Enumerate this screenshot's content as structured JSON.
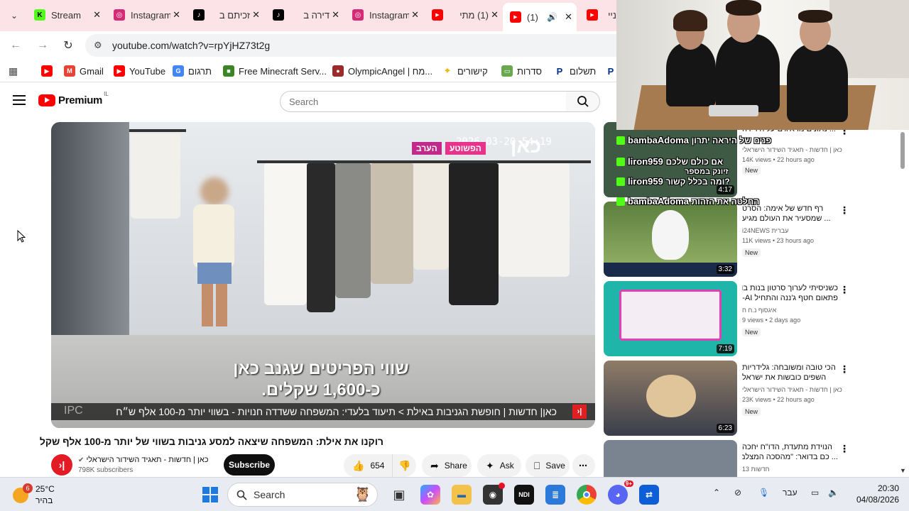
{
  "browser": {
    "tabs": [
      {
        "title": "Stream",
        "favicon": "kick-icon",
        "color": "#53fc18",
        "glyph": "K"
      },
      {
        "title": "Instagram",
        "favicon": "instagram-icon",
        "color": "#d62976",
        "glyph": "◎"
      },
      {
        "title": "זכיתם ב",
        "favicon": "tiktok-icon",
        "color": "#000000",
        "glyph": "♪"
      },
      {
        "title": "דירה ב",
        "favicon": "tiktok-icon",
        "color": "#000000",
        "glyph": "♪"
      },
      {
        "title": "Instagram",
        "favicon": "instagram-icon",
        "color": "#d62976",
        "glyph": "◎"
      },
      {
        "title": "(1) מתי",
        "favicon": "youtube-icon",
        "color": "#ff0000",
        "glyph": "▶"
      },
      {
        "title": "(1)",
        "favicon": "youtube-icon",
        "color": "#ff0000",
        "glyph": "▶",
        "active": true
      },
      {
        "title": "ניי",
        "favicon": "youtube-icon",
        "color": "#ff0000",
        "glyph": "▶"
      }
    ],
    "url": "youtube.com/watch?v=rpYjHZ73t2g",
    "bookmarks": [
      {
        "label": "",
        "icon": "youtube-icon",
        "color": "#ff0000"
      },
      {
        "label": "Gmail",
        "icon": "gmail-icon",
        "color": "#ea4335"
      },
      {
        "label": "YouTube",
        "icon": "youtube-icon",
        "color": "#ff0000"
      },
      {
        "label": "תרגום",
        "icon": "translate-icon",
        "color": "#4285f4"
      },
      {
        "label": "Free Minecraft Serv...",
        "icon": "minecraft-icon",
        "color": "#3c8527"
      },
      {
        "label": "OlympicAngel | מח...",
        "icon": "avatar-icon",
        "color": "#9b2a2a"
      },
      {
        "label": "קישורים",
        "icon": "star-folder-icon",
        "color": "#f4c20d"
      },
      {
        "label": "סדרות",
        "icon": "tv-icon",
        "color": "#6aa84f"
      },
      {
        "label": "תשלום",
        "icon": "paypal-icon",
        "color": "#003087"
      }
    ]
  },
  "youtube": {
    "logo_text": "Premium",
    "country": "IL",
    "search_placeholder": "Search",
    "video": {
      "watermark": "כאן",
      "timestamp": "2026-03-20 54:19",
      "tag1": "הפשוטע",
      "tag2": "הערב",
      "subtitle_line1": "שווי הפריטים שגנב כאן",
      "subtitle_line2": "כ-1,600 שקלים.",
      "ticker_text": "כאן| חדשות  |  חופשת הגניבות באילת > תיעוד בלעדי: המשפחה ששדדה חנויות - בשווי יותר מ-100 אלף ש״ח",
      "ticker_logo": "IPC",
      "brand_glyph": "›|"
    },
    "title": "רוקנו את אילת: המשפחה שיצאה למסע גניבות בשווי של יותר מ-100 אלף שקל",
    "channel": {
      "name": "כאן | חדשות - תאגיד השידור הישראלי",
      "subscribers": "798K subscribers",
      "avatar_glyph": "›|"
    },
    "subscribe_label": "Subscribe",
    "actions": {
      "likes": "654",
      "share": "Share",
      "ask": "Ask",
      "save": "Save"
    },
    "recommendations": [
      {
        "line1": "... נתונים מדאיגים על הירידה",
        "line2": "",
        "channel": "כאן | חדשות - תאגיד השידור הישראלי",
        "meta": "14K views • 22 hours ago",
        "badge": "New",
        "duration": "4:17",
        "thumb": "#3e5a45"
      },
      {
        "line1": "רף חדש של אימה: הסרט",
        "line2": "... שמסעיר את העולם מגיע",
        "channel": "i24NEWS עברית",
        "meta": "11K views • 23 hours ago",
        "badge": "New",
        "duration": "3:32",
        "thumb": "#6b8e4e"
      },
      {
        "line1": "כשניסיתי לערוך סרטון בנות בוק",
        "line2": "פתאום חטף ג'ננה והתחיל AI-...",
        "channel": "איגסוף נ.ח ח",
        "meta": "9 views • 2 days ago",
        "badge": "New",
        "duration": "7:19",
        "thumb": "#1fb5a8"
      },
      {
        "line1": "הכי טובה ומשובחה: גלידריות",
        "line2": "השפים כובשות את ישראל",
        "channel": "כאן | חדשות - תאגיד השידור הישראלי",
        "meta": "23K views • 22 hours ago",
        "badge": "New",
        "duration": "6:23",
        "thumb": "#b88a5a"
      },
      {
        "line1": "הנוידת מתעדת, הדו\"ח יחכה",
        "line2": "... כם בדואר: \"מהסכה המצלמות\"",
        "channel": "חדשות 13",
        "meta": "",
        "badge": "",
        "duration": "",
        "thumb": "#7a8490"
      }
    ]
  },
  "webcam_chat": [
    {
      "user": "bambaAdoma",
      "text": "פנים של היראה יתרון"
    },
    {
      "user": "liron959",
      "text": "אם כולם שלכם"
    },
    {
      "user": "",
      "text": "זיונק במספר"
    },
    {
      "user": "liron959",
      "text": "ומה בכלל קשור?"
    },
    {
      "user": "bambaAdoma",
      "text": "החלטה את הזהות"
    }
  ],
  "taskbar": {
    "temperature": "25°C",
    "weather_label": "בהיר",
    "weather_badge": "6",
    "search_label": "Search",
    "language": "עבר",
    "time": "20:30",
    "date": "04/08/2026",
    "discord_badge": "9+"
  }
}
